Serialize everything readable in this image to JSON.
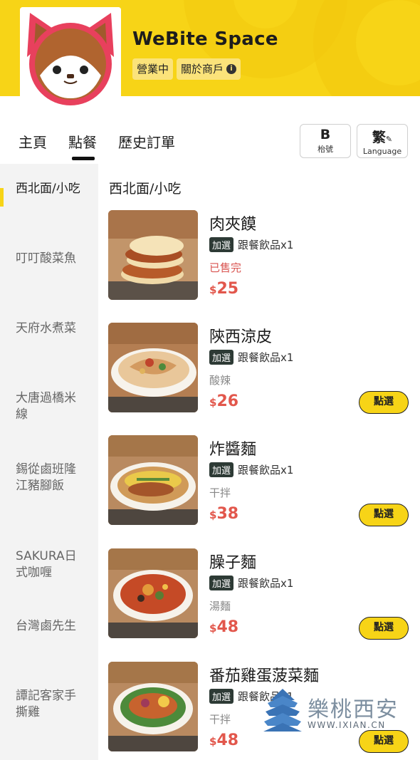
{
  "store": {
    "name": "WeBite Space",
    "status": "營業中",
    "about_label": "關於商戶",
    "info_icon": "info-icon"
  },
  "tabs": [
    {
      "label": "主頁",
      "active": false
    },
    {
      "label": "點餐",
      "active": true
    },
    {
      "label": "歷史訂單",
      "active": false
    }
  ],
  "tools": {
    "table": {
      "value": "B",
      "label": "枱號"
    },
    "language": {
      "value": "繁",
      "label": "Language",
      "icon": "pencil-icon"
    }
  },
  "sidebar": {
    "items": [
      {
        "label": "西北面/小吃",
        "active": true
      },
      {
        "label": "叮叮酸菜魚",
        "active": false
      },
      {
        "label": "天府水煮菜",
        "active": false
      },
      {
        "label": "大唐過橋米線",
        "active": false
      },
      {
        "label": "錫從鹵班隆江豬腳飯",
        "active": false
      },
      {
        "label": "SAKURA日式咖喱",
        "active": false
      },
      {
        "label": "台灣鹵先生",
        "active": false
      },
      {
        "label": "譚記客家手撕雞",
        "active": false
      }
    ]
  },
  "section": {
    "title": "西北面/小吃"
  },
  "dishes": [
    {
      "name": "肉夾饃",
      "combo_badge": "加選",
      "combo_text": "跟餐飲品x1",
      "note": "已售完",
      "currency": "$",
      "price": "25",
      "button": ""
    },
    {
      "name": "陝西涼皮",
      "combo_badge": "加選",
      "combo_text": "跟餐飲品x1",
      "note": "酸辣",
      "currency": "$",
      "price": "26",
      "button": "點選"
    },
    {
      "name": "炸醬麵",
      "combo_badge": "加選",
      "combo_text": "跟餐飲品x1",
      "note": "干拌",
      "currency": "$",
      "price": "38",
      "button": "點選"
    },
    {
      "name": "臊子麵",
      "combo_badge": "加選",
      "combo_text": "跟餐飲品x1",
      "note": "湯麵",
      "currency": "$",
      "price": "48",
      "button": "點選"
    },
    {
      "name": "番茄雞蛋菠菜麵",
      "combo_badge": "加選",
      "combo_text": "跟餐飲品x1",
      "note": "干拌",
      "currency": "$",
      "price": "48",
      "button": "點選"
    }
  ],
  "watermark": {
    "title": "樂桃西安",
    "url": "WWW.IXIAN.CN"
  },
  "colors": {
    "brand_yellow": "#f7d417",
    "price_red": "#e2574c",
    "soldout_red": "#d9534f"
  }
}
